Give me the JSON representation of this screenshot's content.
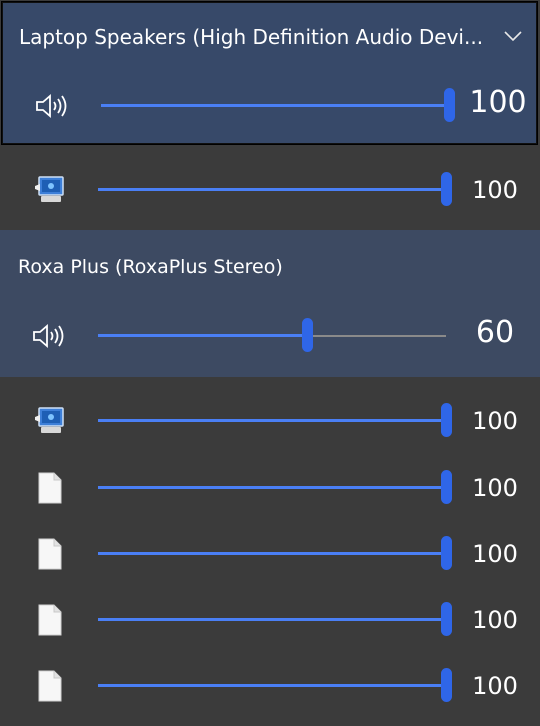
{
  "devices": [
    {
      "title": "Laptop Speakers (High Definition Audio Devi...",
      "icon": "speaker-icon",
      "volume": 100,
      "volume_text": "100"
    },
    {
      "title": "Roxa Plus (RoxaPlus Stereo)",
      "icon": "speaker-icon",
      "volume": 60,
      "volume_text": "60"
    }
  ],
  "apps": [
    {
      "icon": "system-sounds-icon",
      "volume": 100,
      "volume_text": "100"
    },
    {
      "icon": "system-sounds-icon",
      "volume": 100,
      "volume_text": "100"
    },
    {
      "icon": "document-icon",
      "volume": 100,
      "volume_text": "100"
    },
    {
      "icon": "document-icon",
      "volume": 100,
      "volume_text": "100"
    },
    {
      "icon": "document-icon",
      "volume": 100,
      "volume_text": "100"
    },
    {
      "icon": "document-icon",
      "volume": 100,
      "volume_text": "100"
    }
  ],
  "colors": {
    "accent": "#2f66e8",
    "device_bg": "#374969",
    "panel_bg": "#3b3b3b"
  }
}
